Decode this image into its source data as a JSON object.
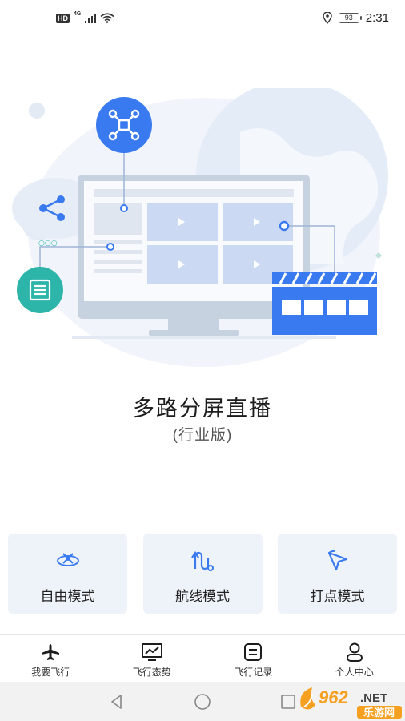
{
  "status_bar": {
    "hd_badge": "HD",
    "network": "4G",
    "battery": "93",
    "time": "2:31"
  },
  "hero": {
    "title": "多路分屏直播",
    "subtitle": "(行业版)"
  },
  "modes": [
    {
      "label": "自由模式",
      "icon": "free-mode-icon"
    },
    {
      "label": "航线模式",
      "icon": "route-mode-icon"
    },
    {
      "label": "打点模式",
      "icon": "waypoint-mode-icon"
    }
  ],
  "bottom_nav": {
    "items": [
      {
        "label": "我要飞行",
        "icon": "plane-icon",
        "active": true
      },
      {
        "label": "飞行态势",
        "icon": "monitor-chart-icon",
        "active": false
      },
      {
        "label": "飞行记录",
        "icon": "log-icon",
        "active": false
      },
      {
        "label": "个人中心",
        "icon": "user-icon",
        "active": false
      }
    ]
  },
  "watermark": {
    "brand": "962",
    "suffix": ".NET",
    "site": "乐游网"
  },
  "colors": {
    "primary_blue": "#3a7af0",
    "teal": "#2cb5a8",
    "card_bg": "#eef3f9",
    "watermark_orange": "#f5a020"
  }
}
